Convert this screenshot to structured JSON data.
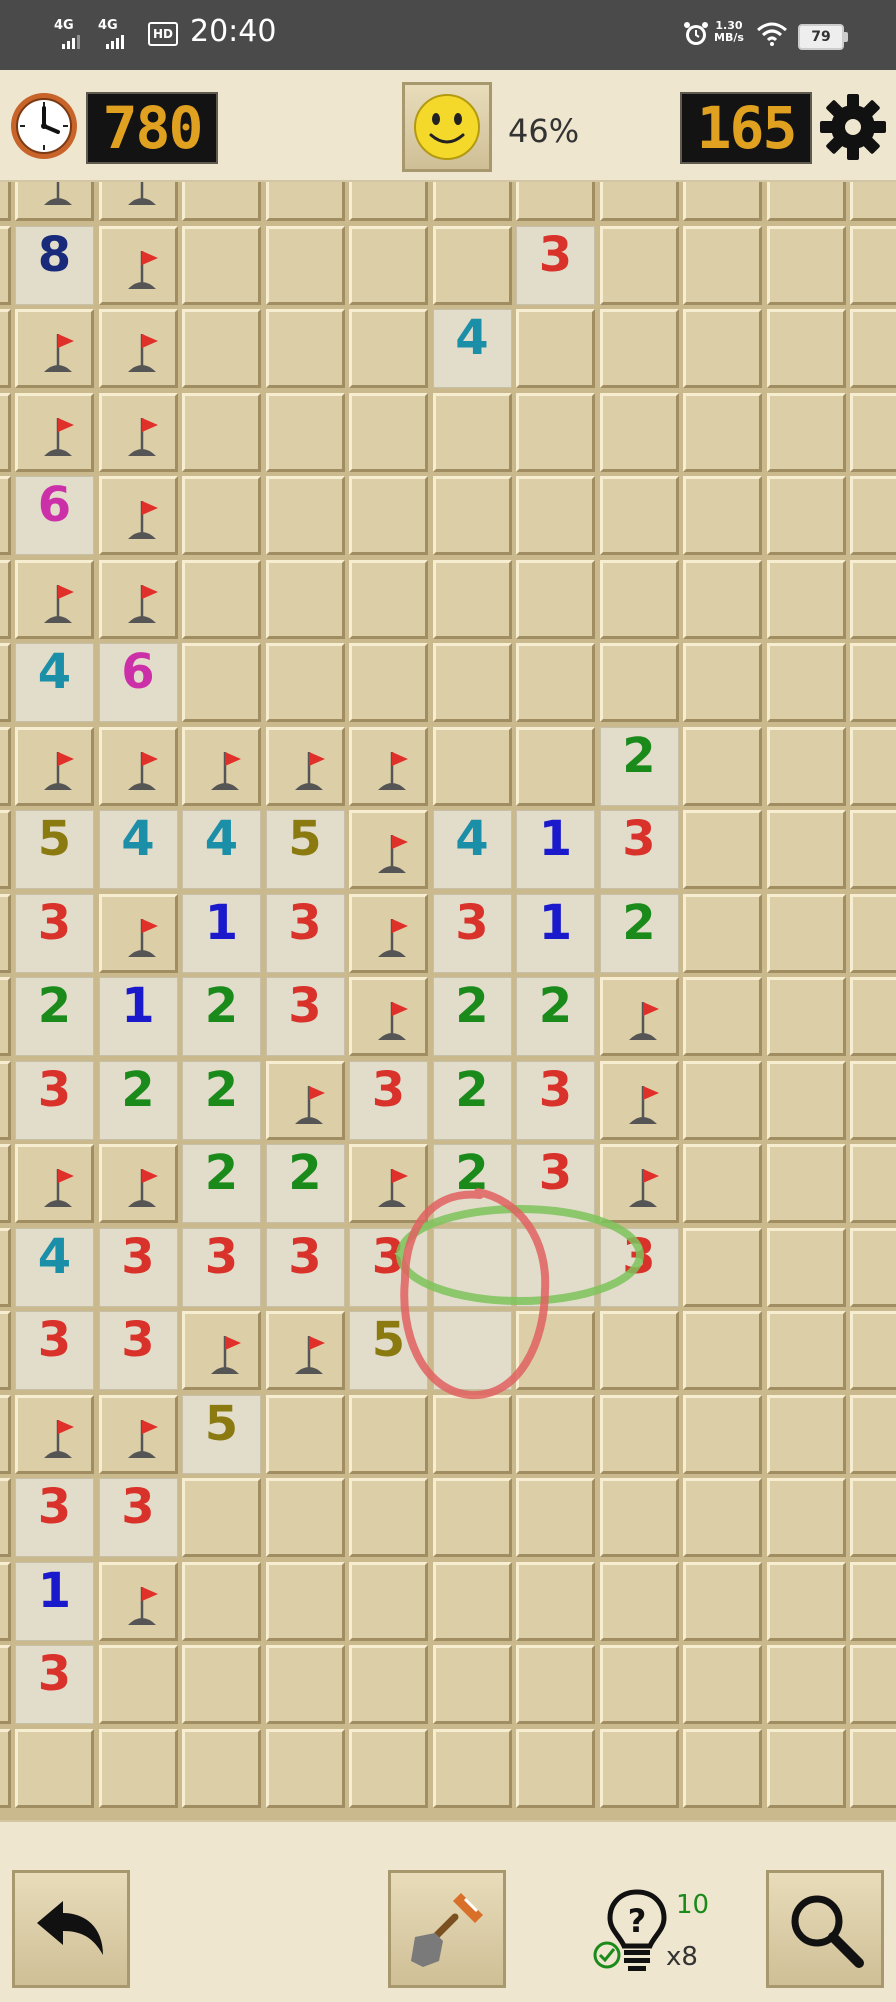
{
  "status_bar": {
    "network1": "4G",
    "network2": "4G",
    "hd": "HD",
    "time": "20:40",
    "speed_value": "1.30",
    "speed_unit": "MB/s",
    "battery": "79"
  },
  "header": {
    "timer": "780",
    "progress": "46%",
    "mines_left": "165",
    "icons": {
      "timer": "clock-icon",
      "face": "smiley-icon",
      "settings": "gear-icon"
    }
  },
  "colors": {
    "1": "#1a1acc",
    "2": "#1a8a1a",
    "3": "#d8322a",
    "4": "#1b8fa8",
    "5": "#8a7a10",
    "6": "#cc30a8",
    "8": "#1a2a7a",
    "lcd": "#e0a020",
    "flag": "#e0302a"
  },
  "board": {
    "rows": [
      [
        "F",
        "F",
        "",
        "",
        "",
        "",
        "",
        "",
        "",
        "",
        ""
      ],
      [
        "8",
        "F",
        "",
        "",
        "",
        "",
        "3",
        "",
        "",
        "",
        ""
      ],
      [
        "F",
        "F",
        "",
        "",
        "",
        "4",
        "",
        "",
        "",
        "",
        ""
      ],
      [
        "F",
        "F",
        "",
        "",
        "",
        "",
        "",
        "",
        "",
        "",
        ""
      ],
      [
        "6",
        "F",
        "",
        "",
        "",
        "",
        "",
        "",
        "",
        "",
        ""
      ],
      [
        "F",
        "F",
        "",
        "",
        "",
        "",
        "",
        "",
        "",
        "",
        ""
      ],
      [
        "4",
        "6",
        "",
        "",
        "",
        "",
        "",
        "",
        "",
        "",
        ""
      ],
      [
        "F",
        "F",
        "F",
        "F",
        "F",
        "",
        "",
        "2",
        "",
        "",
        ""
      ],
      [
        "5",
        "4",
        "4",
        "5",
        "F",
        "4",
        "1",
        "3",
        "",
        "",
        ""
      ],
      [
        "3",
        "F",
        "1",
        "3",
        "F",
        "3",
        "1",
        "2",
        "",
        "",
        ""
      ],
      [
        "2",
        "1",
        "2",
        "3",
        "F",
        "2",
        "2",
        "F",
        "",
        "",
        ""
      ],
      [
        "3",
        "2",
        "2",
        "F",
        "3",
        "2",
        "3",
        "F",
        "",
        "",
        ""
      ],
      [
        "F",
        "F",
        "2",
        "2",
        "F",
        "2",
        "3",
        "F",
        "",
        "",
        ""
      ],
      [
        "4",
        "3",
        "3",
        "3",
        "3",
        "0",
        "0",
        "3",
        "",
        "",
        ""
      ],
      [
        "3",
        "3",
        "F",
        "F",
        "5",
        "0",
        "",
        "",
        "",
        "",
        ""
      ],
      [
        "F",
        "F",
        "5",
        "",
        "",
        "",
        "",
        "",
        "",
        "",
        ""
      ],
      [
        "3",
        "3",
        "",
        "",
        "",
        "",
        "",
        "",
        "",
        "",
        ""
      ],
      [
        "1",
        "F",
        "",
        "",
        "",
        "",
        "",
        "",
        "",
        "",
        ""
      ],
      [
        "3",
        "",
        "",
        "",
        "",
        "",
        "",
        "",
        "",
        "",
        ""
      ],
      [
        "",
        "",
        "",
        "",
        "",
        "",
        "",
        "",
        "",
        "",
        ""
      ]
    ]
  },
  "footer": {
    "hints_count": "10",
    "checks_count": "x8",
    "icons": {
      "undo": "undo-arrow-icon",
      "dig": "shovel-icon",
      "hint": "hint-bulb-icon",
      "zoom": "magnifier-icon"
    }
  }
}
